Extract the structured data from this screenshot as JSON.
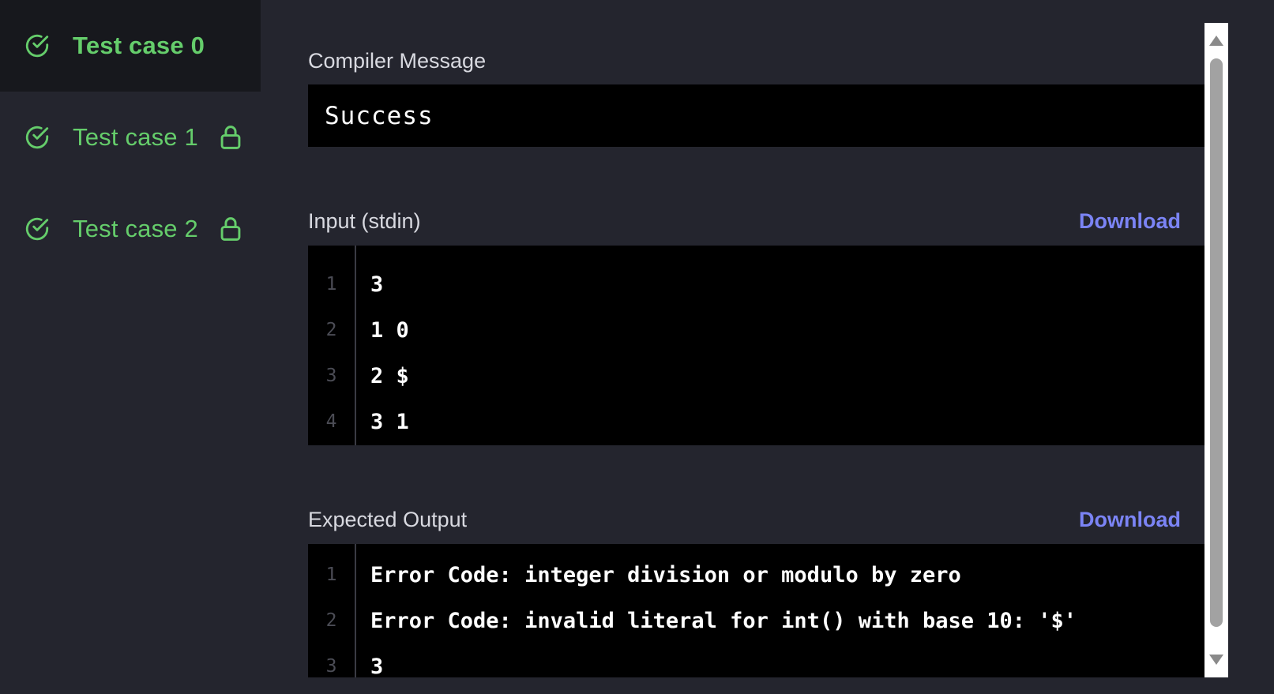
{
  "sidebar": {
    "test_cases": [
      {
        "label": "Test case 0",
        "active": true,
        "locked": false
      },
      {
        "label": "Test case 1",
        "active": false,
        "locked": true
      },
      {
        "label": "Test case 2",
        "active": false,
        "locked": true
      }
    ]
  },
  "compiler": {
    "title": "Compiler Message",
    "message": "Success"
  },
  "input": {
    "title": "Input (stdin)",
    "download_label": "Download",
    "lines": [
      {
        "num": "1",
        "text": "3"
      },
      {
        "num": "2",
        "text": "1 0"
      },
      {
        "num": "3",
        "text": "2 $"
      },
      {
        "num": "4",
        "text": "3 1"
      }
    ]
  },
  "expected": {
    "title": "Expected Output",
    "download_label": "Download",
    "lines": [
      {
        "num": "1",
        "text": "Error Code: integer division or modulo by zero"
      },
      {
        "num": "2",
        "text": "Error Code: invalid literal for int() with base 10: '$'"
      },
      {
        "num": "3",
        "text": "3"
      }
    ]
  },
  "colors": {
    "accent_green": "#65cd6b",
    "link_blue": "#7b84f5",
    "background": "#24252e"
  }
}
